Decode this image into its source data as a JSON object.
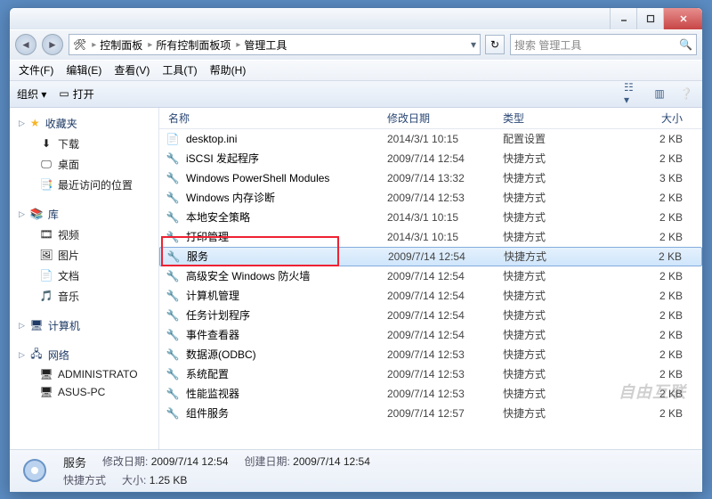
{
  "breadcrumbs": [
    "控制面板",
    "所有控制面板项",
    "管理工具"
  ],
  "search_placeholder": "搜索 管理工具",
  "menus": {
    "file": "文件(F)",
    "edit": "编辑(E)",
    "view": "查看(V)",
    "tools": "工具(T)",
    "help": "帮助(H)"
  },
  "toolbar": {
    "organize": "组织 ▾",
    "open": "打开"
  },
  "columns": {
    "name": "名称",
    "modified": "修改日期",
    "type": "类型",
    "size": "大小"
  },
  "sidebar": {
    "favorites": {
      "label": "收藏夹",
      "items": [
        {
          "label": "下载",
          "icon": "download"
        },
        {
          "label": "桌面",
          "icon": "desktop"
        },
        {
          "label": "最近访问的位置",
          "icon": "recent"
        }
      ]
    },
    "libraries": {
      "label": "库",
      "items": [
        {
          "label": "视频",
          "icon": "video"
        },
        {
          "label": "图片",
          "icon": "picture"
        },
        {
          "label": "文档",
          "icon": "document"
        },
        {
          "label": "音乐",
          "icon": "music"
        }
      ]
    },
    "computer": {
      "label": "计算机",
      "items": []
    },
    "network": {
      "label": "网络",
      "items": [
        {
          "label": "ADMINISTRATO",
          "icon": "pc"
        },
        {
          "label": "ASUS-PC",
          "icon": "pc"
        }
      ]
    }
  },
  "files": [
    {
      "name": "desktop.ini",
      "date": "2014/3/1 10:15",
      "type": "配置设置",
      "size": "2 KB"
    },
    {
      "name": "iSCSI 发起程序",
      "date": "2009/7/14 12:54",
      "type": "快捷方式",
      "size": "2 KB"
    },
    {
      "name": "Windows PowerShell Modules",
      "date": "2009/7/14 13:32",
      "type": "快捷方式",
      "size": "3 KB"
    },
    {
      "name": "Windows 内存诊断",
      "date": "2009/7/14 12:53",
      "type": "快捷方式",
      "size": "2 KB"
    },
    {
      "name": "本地安全策略",
      "date": "2014/3/1 10:15",
      "type": "快捷方式",
      "size": "2 KB"
    },
    {
      "name": "打印管理",
      "date": "2014/3/1 10:15",
      "type": "快捷方式",
      "size": "2 KB"
    },
    {
      "name": "服务",
      "date": "2009/7/14 12:54",
      "type": "快捷方式",
      "size": "2 KB",
      "selected": true
    },
    {
      "name": "高级安全 Windows 防火墙",
      "date": "2009/7/14 12:54",
      "type": "快捷方式",
      "size": "2 KB"
    },
    {
      "name": "计算机管理",
      "date": "2009/7/14 12:54",
      "type": "快捷方式",
      "size": "2 KB"
    },
    {
      "name": "任务计划程序",
      "date": "2009/7/14 12:54",
      "type": "快捷方式",
      "size": "2 KB"
    },
    {
      "name": "事件查看器",
      "date": "2009/7/14 12:54",
      "type": "快捷方式",
      "size": "2 KB"
    },
    {
      "name": "数据源(ODBC)",
      "date": "2009/7/14 12:53",
      "type": "快捷方式",
      "size": "2 KB"
    },
    {
      "name": "系统配置",
      "date": "2009/7/14 12:53",
      "type": "快捷方式",
      "size": "2 KB"
    },
    {
      "name": "性能监视器",
      "date": "2009/7/14 12:53",
      "type": "快捷方式",
      "size": "2 KB"
    },
    {
      "name": "组件服务",
      "date": "2009/7/14 12:57",
      "type": "快捷方式",
      "size": "2 KB"
    }
  ],
  "status": {
    "title": "服务",
    "modified_label": "修改日期:",
    "modified": "2009/7/14 12:54",
    "created_label": "创建日期:",
    "created": "2009/7/14 12:54",
    "type_label": "快捷方式",
    "size_label": "大小:",
    "size": "1.25 KB"
  },
  "watermark": "自由互联"
}
